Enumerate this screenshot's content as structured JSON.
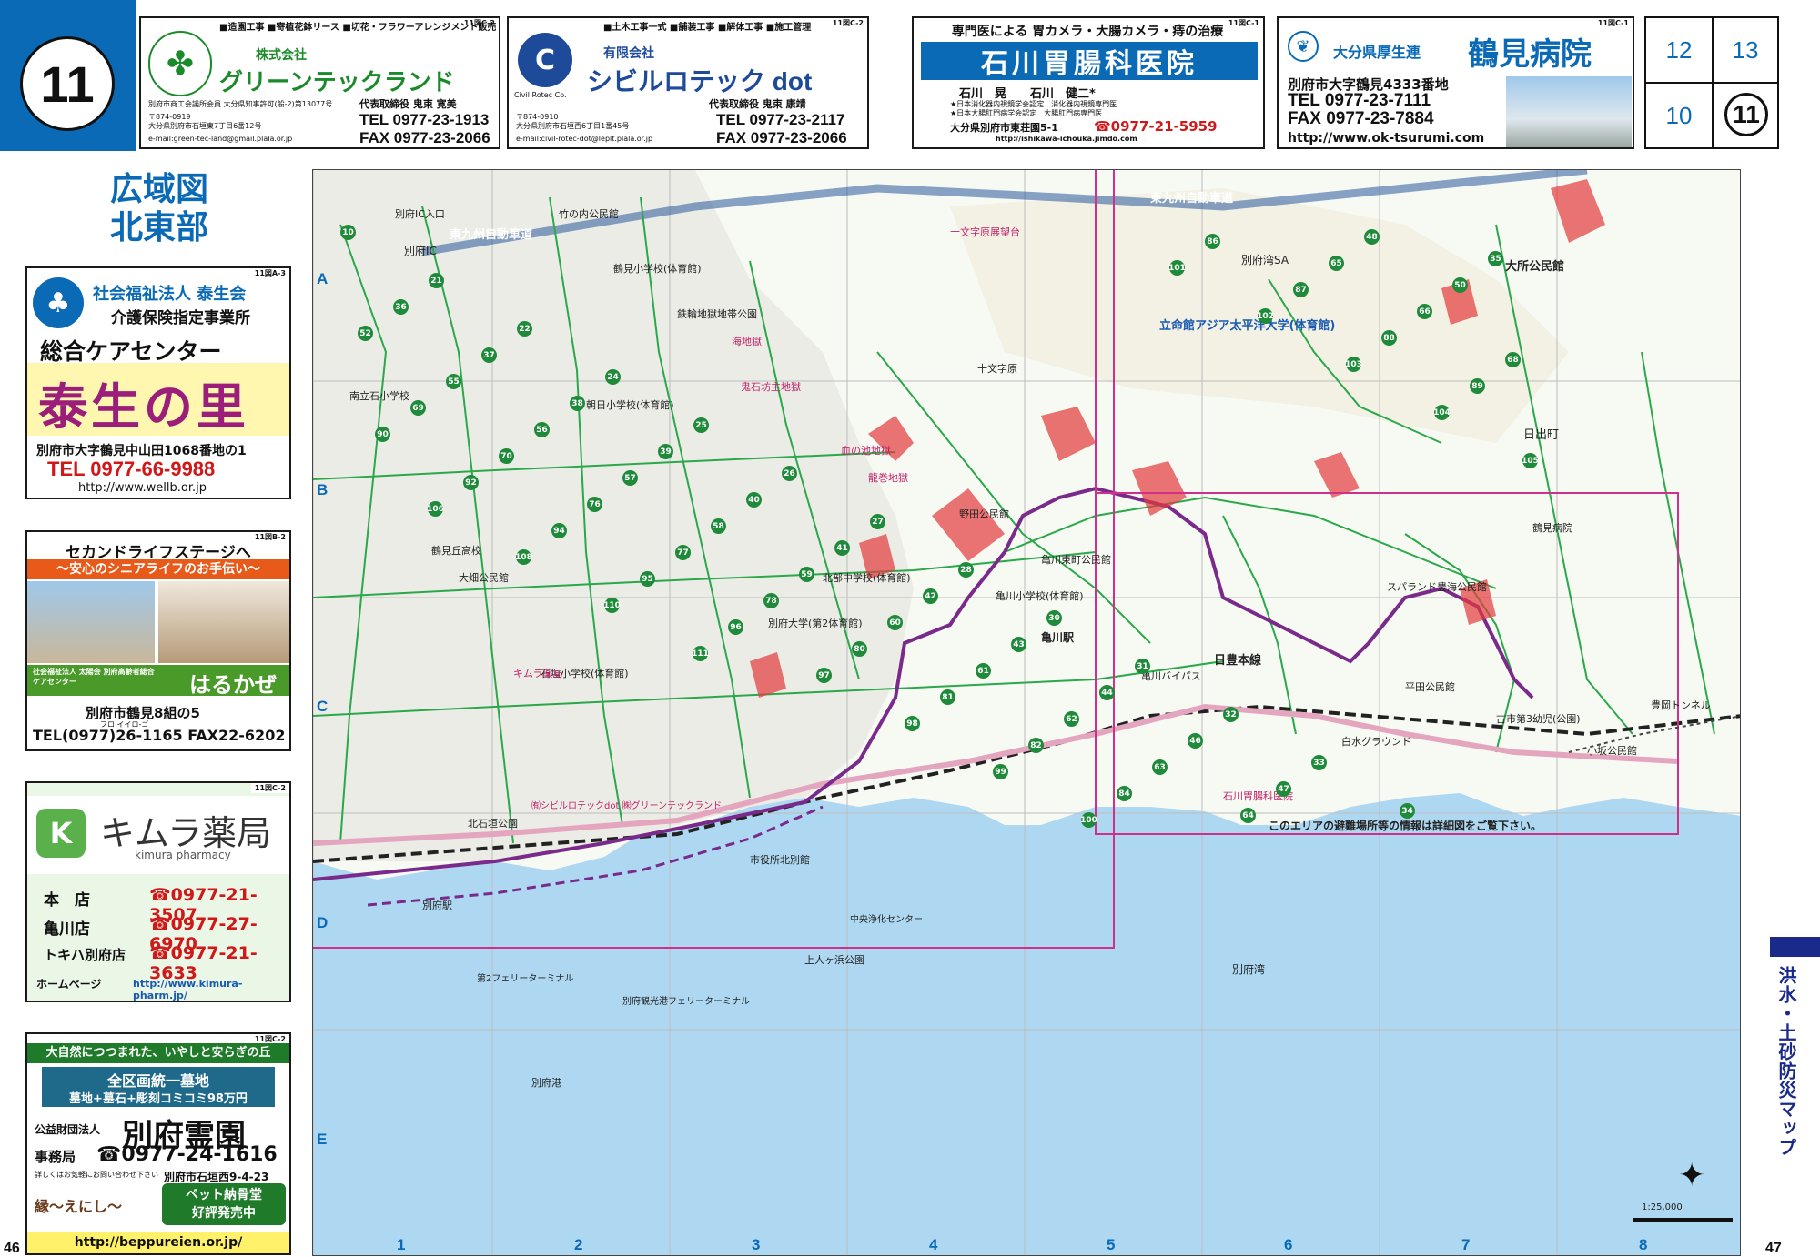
{
  "page": {
    "badge_number": "11",
    "left_page_number": "46",
    "right_page_number": "47",
    "area_title_line1": "広域図",
    "area_title_line2": "北東部",
    "side_tab_text": "洪水・土砂防災マップ"
  },
  "colors": {
    "brand_blue": "#0a6ab6",
    "sea_blue": "#aed8f2",
    "road_green": "#2aa84a",
    "route_purple": "#7a2a8a",
    "hazard_red": "#e23a3a",
    "boundary_magenta": "#d0308a"
  },
  "index_box": {
    "cells": [
      "12",
      "13",
      "10",
      "11"
    ],
    "current": "11"
  },
  "ads": {
    "greentech": {
      "ref": "11図C-2",
      "services": "■造園工事 ■寄植花鉢リース ■切花・フラワーアレンジメント販売",
      "company_prefix": "株式会社",
      "company": "グリーンテックランド",
      "license": "別府市商工会議所会員 大分県知事許可(般-2)第13077号",
      "rep": "代表取締役 鬼束 寛美",
      "postal": "〒874-0919",
      "address": "大分県別府市石垣東7丁目6番12号",
      "tel": "TEL 0977-23-1913",
      "fax": "FAX 0977-23-2066",
      "email": "e-mail:green-tec-land@gmail.plala.or.jp"
    },
    "civil": {
      "ref": "11図C-2",
      "services": "■土木工事一式 ■舗装工事 ■解体工事 ■施工管理",
      "company_prefix": "有限会社",
      "company": "シビルロテック dot",
      "logo_text": "Civil Rotec Co.",
      "rep": "代表取締役 鬼束 康靖",
      "postal": "〒874-0910",
      "address": "大分県別府市石垣西6丁目1番45号",
      "tel": "TEL 0977-23-2117",
      "fax": "FAX 0977-23-2066",
      "email": "e-mail:civil-rotec-dot@leplt.plala.or.jp"
    },
    "ishikawa": {
      "ref": "11図C-1",
      "headline": "専門医による 胃カメラ・大腸カメラ・痔の治療",
      "name": "石川胃腸科医院",
      "doctors": "石川　晃　　石川　健二*",
      "cert1": "★日本消化器内視鏡学会認定　消化器内視鏡専門医",
      "cert2": "★日本大腸肛門病学会認定　大腸肛門病専門医",
      "address": "大分県別府市東荘園5-1",
      "tel": "☎0977-21-5959",
      "url": "http://ishikawa-ichouka.jimdo.com"
    },
    "tsurumi": {
      "ref": "11図C-1",
      "org": "大分県厚生連",
      "name": "鶴見病院",
      "address": "別府市大字鶴見4333番地",
      "tel": "TEL 0977-23-7111",
      "fax": "FAX 0977-23-7884",
      "url": "http://www.ok-tsurumi.com"
    },
    "taiseikai": {
      "ref": "11図A-3",
      "org": "社会福祉法人 泰生会",
      "service": "介護保険指定事業所",
      "center": "総合ケアセンター",
      "name": "泰生の里",
      "address": "別府市大字鶴見中山田1068番地の1",
      "tel": "TEL 0977-66-9988",
      "url": "http://www.wellb.or.jp"
    },
    "harukaze": {
      "ref": "11図B-2",
      "headline": "セカンドライフステージへ",
      "tagline": "〜安心のシニアライフのお手伝い〜",
      "org": "社会福祉法人 太陽会 別府高齢者総合ケアセンター",
      "name": "はるかぜ",
      "address": "別府市鶴見8組の5",
      "tel": "TEL(0977)26-1165 FAX22-6202",
      "ruby": "フロ イイロ-ゴ"
    },
    "kimura": {
      "ref": "11図C-2",
      "name": "キムラ薬局",
      "name_en": "kimura pharmacy",
      "stores": [
        {
          "label": "本　店",
          "tel": "☎0977-21-3507"
        },
        {
          "label": "亀川店",
          "tel": "☎0977-27-6970"
        },
        {
          "label": "トキハ別府店",
          "tel": "☎0977-21-3633"
        }
      ],
      "homepage_label": "ホームページ",
      "homepage": "http://www.kimura-pharm.jp/"
    },
    "reien": {
      "ref": "11図C-2",
      "headline": "大自然につつまれた、いやしと安らぎの丘",
      "banner1": "全区画統一墓地",
      "banner2": "墓地+墓石+彫刻コミコミ98万円",
      "org": "公益財団法人",
      "name": "別府霊園",
      "office_label": "事務局",
      "tel": "☎0977-24-1616",
      "detail": "詳しくはお気軽にお問い合わせ下さい",
      "address": "別府市石垣西9-4-23",
      "promo1": "ペット納骨堂",
      "promo2": "好評発売中",
      "brand": "縁〜えにし〜",
      "url": "http://beppureien.or.jp/"
    }
  },
  "map": {
    "columns": [
      "1",
      "2",
      "3",
      "4",
      "5",
      "6",
      "7",
      "8"
    ],
    "rows": [
      "A",
      "B",
      "C",
      "D",
      "E"
    ],
    "scale": "1:25,000",
    "notice": "このエリアの避難場所等の情報は詳細図をご覧下さい。",
    "labels": [
      {
        "id": "expressway1",
        "text": "東九州自動車道"
      },
      {
        "id": "expressway2",
        "text": "東九州自動車道"
      },
      {
        "id": "beppu_ic",
        "text": "別府IC"
      },
      {
        "id": "beppu_ic_entry",
        "text": "別府IC入口"
      },
      {
        "id": "beppu_bay_sa",
        "text": "別府湾SA"
      },
      {
        "id": "ritsumeikan",
        "text": "立命館アジア太平洋大学(体育館)"
      },
      {
        "id": "ootokoro",
        "text": "大所公民館"
      },
      {
        "id": "hidemachi",
        "text": "日出町"
      },
      {
        "id": "kamegawa_st",
        "text": "亀川駅"
      },
      {
        "id": "beppu_st",
        "text": "別府駅"
      },
      {
        "id": "nippo_line",
        "text": "日豊本線"
      },
      {
        "id": "kamegawa_bypass",
        "text": "亀川バイパス"
      },
      {
        "id": "beppu_bay",
        "text": "別府湾"
      },
      {
        "id": "beppu_port",
        "text": "別府港"
      },
      {
        "id": "ferry2",
        "text": "第2フェリーターミナル"
      },
      {
        "id": "ferry_kansai",
        "text": "別府観光港フェリーターミナル"
      },
      {
        "id": "tsurumi_kohaku",
        "text": "鶴見小学校(体育館)"
      },
      {
        "id": "asahi",
        "text": "朝日小学校(体育館)"
      },
      {
        "id": "kitasumiyoshi",
        "text": "北部中学校(体育館)"
      },
      {
        "id": "kamegawa_sho",
        "text": "亀川小学校(体育館)"
      },
      {
        "id": "beppu_univ",
        "text": "別府大学(第2体育館)"
      },
      {
        "id": "ishigaki_sho",
        "text": "石垣小学校(体育館)"
      },
      {
        "id": "nanri",
        "text": "南立石小学校"
      },
      {
        "id": "tsurumigaoka",
        "text": "鶴見丘高校"
      },
      {
        "id": "kitahama",
        "text": "北石垣公園"
      },
      {
        "id": "kamiyama",
        "text": "上人ヶ浜公園"
      },
      {
        "id": "nozoki",
        "text": "野田公民館"
      },
      {
        "id": "ooyama",
        "text": "大畑公民館"
      },
      {
        "id": "shiiba",
        "text": "古市第3幼児(公園)"
      },
      {
        "id": "kosaka",
        "text": "小坂公民館"
      },
      {
        "id": "hirata",
        "text": "平田公民館"
      },
      {
        "id": "spaland",
        "text": "スパランド豊海公民館"
      },
      {
        "id": "beppu_tunnel",
        "text": "豊岡トンネル"
      },
      {
        "id": "chuo_senter",
        "text": "中央浄化センター"
      },
      {
        "id": "tsurumiyama",
        "text": "鶴見病院"
      },
      {
        "id": "ishikawa_clinic",
        "text": "石川胃腸科医院"
      },
      {
        "id": "kimura_ph",
        "text": "キムラ薬局"
      },
      {
        "id": "civil_loc",
        "text": "㈲シビルロテックdot ㈱グリーンテックランド"
      },
      {
        "id": "jijikan",
        "text": "市役所北別館"
      },
      {
        "id": "kamegawa_higashi",
        "text": "亀川東町公民館"
      },
      {
        "id": "shirakobe",
        "text": "白水グラウンド"
      },
      {
        "id": "tamachi",
        "text": "竹の内公民館"
      },
      {
        "id": "chushin",
        "text": "鉄輪地獄地帯公園"
      },
      {
        "id": "oni",
        "text": "鬼石坊主地獄"
      },
      {
        "id": "umi",
        "text": "海地獄"
      },
      {
        "id": "chi",
        "text": "血の池地獄"
      },
      {
        "id": "tatsumaki",
        "text": "龍巻地獄"
      },
      {
        "id": "kodomo",
        "text": "十文字原展望台"
      },
      {
        "id": "jumonji",
        "text": "十文字原"
      }
    ],
    "numbered_points": [
      "10",
      "21",
      "22",
      "24",
      "25",
      "26",
      "27",
      "28",
      "30",
      "31",
      "32",
      "33",
      "34",
      "35",
      "36",
      "37",
      "38",
      "39",
      "40",
      "41",
      "42",
      "43",
      "44",
      "46",
      "47",
      "48",
      "50",
      "52",
      "55",
      "56",
      "57",
      "58",
      "59",
      "60",
      "61",
      "62",
      "63",
      "64",
      "65",
      "66",
      "68",
      "69",
      "70",
      "76",
      "77",
      "78",
      "80",
      "81",
      "82",
      "84",
      "86",
      "87",
      "88",
      "89",
      "90",
      "92",
      "94",
      "95",
      "96",
      "97",
      "98",
      "99",
      "100",
      "101",
      "102",
      "103",
      "104",
      "105",
      "106",
      "108",
      "110",
      "111"
    ]
  }
}
